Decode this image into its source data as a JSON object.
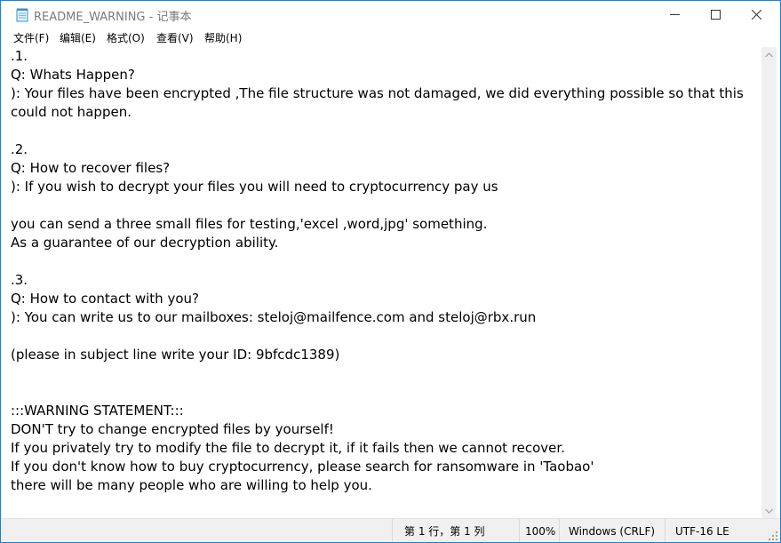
{
  "window": {
    "title": "README_WARNING - 记事本"
  },
  "menu": [
    {
      "label": "文件(F)"
    },
    {
      "label": "编辑(E)"
    },
    {
      "label": "格式(O)"
    },
    {
      "label": "查看(V)"
    },
    {
      "label": "帮助(H)"
    }
  ],
  "document": {
    "text": ".1.\nQ: Whats Happen?\n): Your files have been encrypted ,The file structure was not damaged, we did everything possible so that this could not happen.\n\n.2.\nQ: How to recover files?\n): If you wish to decrypt your files you will need to cryptocurrency pay us\n\nyou can send a three small files for testing,'excel ,word,jpg' something.\nAs a guarantee of our decryption ability.\n\n.3.\nQ: How to contact with you?\n): You can write us to our mailboxes: steloj@mailfence.com and steloj@rbx.run\n\n(please in subject line write your ID: 9bfcdc1389)\n\n\n:::WARNING STATEMENT:::\nDON'T try to change encrypted files by yourself!\nIf you privately try to modify the file to decrypt it, if it fails then we cannot recover.\nIf you don't know how to buy cryptocurrency, please search for ransomware in 'Taobao'\nthere will be many people who are willing to help you."
  },
  "status": {
    "position": "第 1 行，第 1 列",
    "zoom": "100%",
    "line_ending": "Windows (CRLF)",
    "encoding": "UTF-16 LE"
  },
  "colors": {
    "title_text": "#7a7a7a",
    "window_border": "#1883d7",
    "statusbar_bg": "#f0f0f0"
  },
  "icons": {
    "app": "notepad-icon",
    "minimize": "minimize-icon",
    "maximize": "maximize-icon",
    "close": "close-icon",
    "scroll_up": "chevron-up-icon",
    "scroll_down": "chevron-down-icon",
    "grip": "resize-grip-icon"
  }
}
